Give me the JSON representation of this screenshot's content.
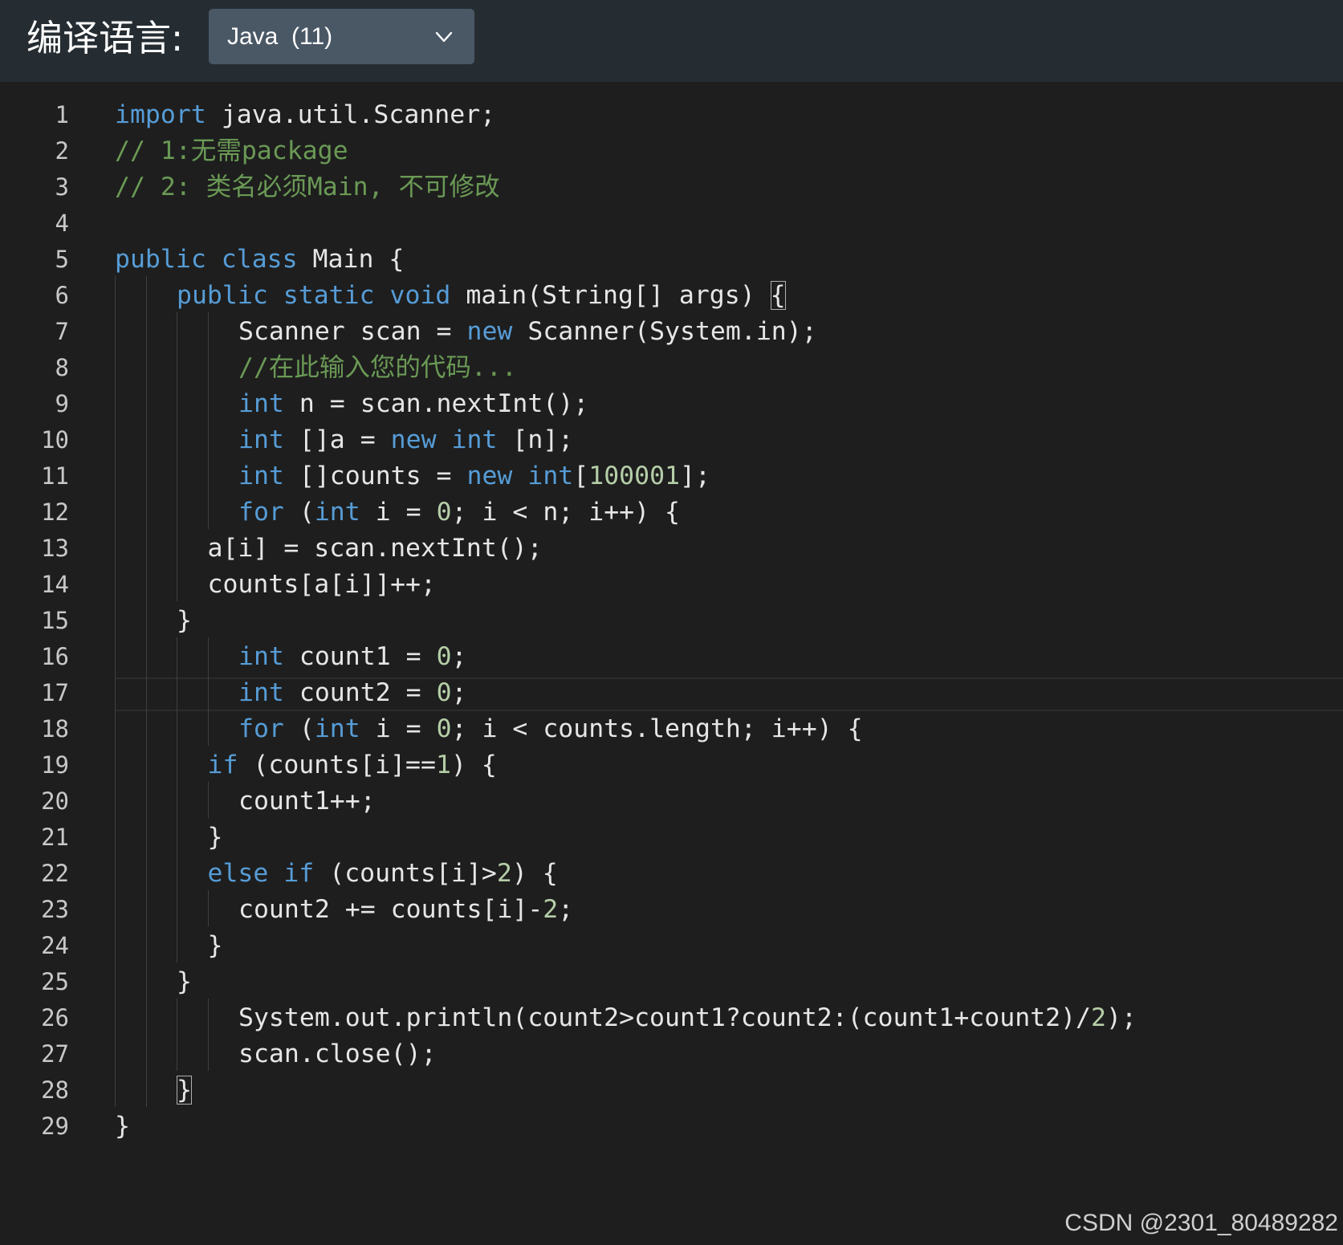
{
  "header": {
    "language_label": "编译语言:",
    "language_select": {
      "value": "Java  (11)",
      "icon": "chevron-down-icon"
    }
  },
  "editor": {
    "language": "java",
    "current_line": 16,
    "lines": [
      {
        "n": "1",
        "indent": 0,
        "tokens": [
          {
            "t": "kw",
            "v": "import"
          },
          {
            "t": "tx",
            "v": " java.util.Scanner;"
          }
        ]
      },
      {
        "n": "2",
        "indent": 0,
        "tokens": [
          {
            "t": "cm",
            "v": "// 1:无需package"
          }
        ]
      },
      {
        "n": "3",
        "indent": 0,
        "tokens": [
          {
            "t": "cm",
            "v": "// 2: 类名必须Main, 不可修改"
          }
        ]
      },
      {
        "n": "4",
        "indent": 0,
        "tokens": []
      },
      {
        "n": "5",
        "indent": 0,
        "tokens": [
          {
            "t": "kw",
            "v": "public"
          },
          {
            "t": "tx",
            "v": " "
          },
          {
            "t": "kw",
            "v": "class"
          },
          {
            "t": "tx",
            "v": " Main {"
          }
        ]
      },
      {
        "n": "6",
        "indent": 2,
        "tokens": [
          {
            "t": "kw",
            "v": "public"
          },
          {
            "t": "tx",
            "v": " "
          },
          {
            "t": "kw",
            "v": "static"
          },
          {
            "t": "tx",
            "v": " "
          },
          {
            "t": "kw",
            "v": "void"
          },
          {
            "t": "tx",
            "v": " main(String[] args) "
          },
          {
            "t": "hl",
            "v": "{"
          }
        ]
      },
      {
        "n": "7",
        "indent": 4,
        "tokens": [
          {
            "t": "tx",
            "v": "Scanner scan = "
          },
          {
            "t": "kw",
            "v": "new"
          },
          {
            "t": "tx",
            "v": " Scanner(System.in);"
          }
        ]
      },
      {
        "n": "8",
        "indent": 4,
        "tokens": [
          {
            "t": "cm",
            "v": "//在此输入您的代码..."
          }
        ]
      },
      {
        "n": "9",
        "indent": 4,
        "tokens": [
          {
            "t": "kw",
            "v": "int"
          },
          {
            "t": "tx",
            "v": " n = scan.nextInt();"
          }
        ]
      },
      {
        "n": "10",
        "indent": 4,
        "tokens": [
          {
            "t": "kw",
            "v": "int"
          },
          {
            "t": "tx",
            "v": " []a = "
          },
          {
            "t": "kw",
            "v": "new"
          },
          {
            "t": "tx",
            "v": " "
          },
          {
            "t": "kw",
            "v": "int"
          },
          {
            "t": "tx",
            "v": " [n];"
          }
        ]
      },
      {
        "n": "11",
        "indent": 4,
        "tokens": [
          {
            "t": "kw",
            "v": "int"
          },
          {
            "t": "tx",
            "v": " []counts = "
          },
          {
            "t": "kw",
            "v": "new"
          },
          {
            "t": "tx",
            "v": " "
          },
          {
            "t": "kw",
            "v": "int"
          },
          {
            "t": "tx",
            "v": "["
          },
          {
            "t": "num",
            "v": "100001"
          },
          {
            "t": "tx",
            "v": "];"
          }
        ]
      },
      {
        "n": "12",
        "indent": 4,
        "tokens": [
          {
            "t": "kw",
            "v": "for"
          },
          {
            "t": "tx",
            "v": " ("
          },
          {
            "t": "kw",
            "v": "int"
          },
          {
            "t": "tx",
            "v": " i = "
          },
          {
            "t": "num",
            "v": "0"
          },
          {
            "t": "tx",
            "v": "; i < n; i++) {"
          }
        ]
      },
      {
        "n": "13",
        "indent": 3,
        "tokens": [
          {
            "t": "tx",
            "v": "a[i] = scan.nextInt();"
          }
        ]
      },
      {
        "n": "14",
        "indent": 3,
        "tokens": [
          {
            "t": "tx",
            "v": "counts[a[i]]++;"
          }
        ]
      },
      {
        "n": "15",
        "indent": 2,
        "tokens": [
          {
            "t": "tx",
            "v": "}"
          }
        ]
      },
      {
        "n": "16",
        "indent": 4,
        "tokens": [
          {
            "t": "kw",
            "v": "int"
          },
          {
            "t": "tx",
            "v": " count1 = "
          },
          {
            "t": "num",
            "v": "0"
          },
          {
            "t": "tx",
            "v": ";"
          }
        ]
      },
      {
        "n": "17",
        "indent": 4,
        "tokens": [
          {
            "t": "kw",
            "v": "int"
          },
          {
            "t": "tx",
            "v": " count2 = "
          },
          {
            "t": "num",
            "v": "0"
          },
          {
            "t": "tx",
            "v": ";"
          }
        ]
      },
      {
        "n": "18",
        "indent": 4,
        "tokens": [
          {
            "t": "kw",
            "v": "for"
          },
          {
            "t": "tx",
            "v": " ("
          },
          {
            "t": "kw",
            "v": "int"
          },
          {
            "t": "tx",
            "v": " i = "
          },
          {
            "t": "num",
            "v": "0"
          },
          {
            "t": "tx",
            "v": "; i < counts.length; i++) {"
          }
        ]
      },
      {
        "n": "19",
        "indent": 3,
        "tokens": [
          {
            "t": "kw",
            "v": "if"
          },
          {
            "t": "tx",
            "v": " (counts[i]=="
          },
          {
            "t": "num",
            "v": "1"
          },
          {
            "t": "tx",
            "v": ") {"
          }
        ]
      },
      {
        "n": "20",
        "indent": 4,
        "tokens": [
          {
            "t": "tx",
            "v": "count1++;"
          }
        ]
      },
      {
        "n": "21",
        "indent": 3,
        "tokens": [
          {
            "t": "tx",
            "v": "}"
          }
        ]
      },
      {
        "n": "22",
        "indent": 3,
        "tokens": [
          {
            "t": "kw",
            "v": "else"
          },
          {
            "t": "tx",
            "v": " "
          },
          {
            "t": "kw",
            "v": "if"
          },
          {
            "t": "tx",
            "v": " (counts[i]>"
          },
          {
            "t": "num",
            "v": "2"
          },
          {
            "t": "tx",
            "v": ") {"
          }
        ]
      },
      {
        "n": "23",
        "indent": 4,
        "tokens": [
          {
            "t": "tx",
            "v": "count2 += counts[i]-"
          },
          {
            "t": "num",
            "v": "2"
          },
          {
            "t": "tx",
            "v": ";"
          }
        ]
      },
      {
        "n": "24",
        "indent": 3,
        "tokens": [
          {
            "t": "tx",
            "v": "}"
          }
        ]
      },
      {
        "n": "25",
        "indent": 2,
        "tokens": [
          {
            "t": "tx",
            "v": "}"
          }
        ]
      },
      {
        "n": "26",
        "indent": 4,
        "tokens": [
          {
            "t": "tx",
            "v": "System.out.println(count2>count1?count2:(count1+count2)/"
          },
          {
            "t": "num",
            "v": "2"
          },
          {
            "t": "tx",
            "v": ");"
          }
        ]
      },
      {
        "n": "27",
        "indent": 4,
        "tokens": [
          {
            "t": "tx",
            "v": "scan.close();"
          }
        ]
      },
      {
        "n": "28",
        "indent": 2,
        "tokens": [
          {
            "t": "hl",
            "v": "}"
          }
        ]
      },
      {
        "n": "29",
        "indent": 0,
        "tokens": [
          {
            "t": "tx",
            "v": "}"
          }
        ]
      }
    ]
  },
  "watermark": "CSDN @2301_80489282",
  "colors": {
    "header_bg": "#252d33",
    "select_bg": "#4a5866",
    "editor_bg": "#1e1e1e",
    "keyword": "#569cd6",
    "comment": "#6a9955",
    "number": "#b5cea8",
    "text": "#e6e6e6",
    "line_number": "#c8c8c8"
  }
}
